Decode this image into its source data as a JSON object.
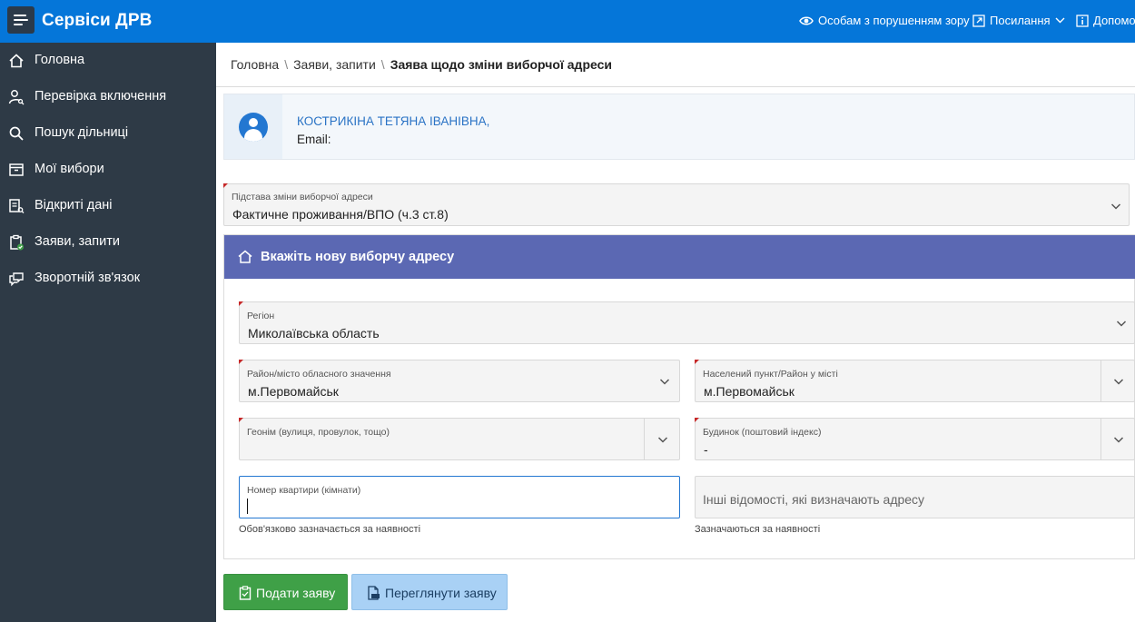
{
  "header": {
    "app_title": "Сервіси ДРВ",
    "accessibility_label": "Особам з порушенням зору",
    "links_label": "Посилання",
    "help_label": "Допомо"
  },
  "sidebar": {
    "items": [
      {
        "label": "Головна",
        "icon": "home-icon"
      },
      {
        "label": "Перевірка включення",
        "icon": "user-search-icon"
      },
      {
        "label": "Пошук дільниці",
        "icon": "search-icon"
      },
      {
        "label": "Мої вибори",
        "icon": "archive-box-icon"
      },
      {
        "label": "Відкриті дані",
        "icon": "database-icon"
      },
      {
        "label": "Заяви, запити",
        "icon": "clipboard-check-icon"
      },
      {
        "label": "Зворотній зв'язок",
        "icon": "chat-bubbles-icon"
      }
    ]
  },
  "breadcrumb": {
    "home": "Головна",
    "section": "Заяви, запити",
    "current": "Заява щодо зміни виборчої адреси"
  },
  "user": {
    "name": "КОСТРИКІНА ТЕТЯНА ІВАНІВНА,",
    "email_label": "Email:"
  },
  "form": {
    "reason": {
      "label": "Підстава зміни виборчої адреси",
      "value": "Фактичне проживання/ВПО (ч.3 ст.8)"
    },
    "address_section_title": "Вкажіть нову виборчу адресу",
    "region": {
      "label": "Регіон",
      "value": "Миколаївська область"
    },
    "district": {
      "label": "Район/місто обласного значення",
      "value": "м.Первомайськ"
    },
    "settlement": {
      "label": "Населений пункт/Район у місті",
      "value": "м.Первомайськ"
    },
    "street": {
      "label": "Геонім (вулиця, провулок, тощо)",
      "value": ""
    },
    "building": {
      "label": "Будинок (поштовий індекс)",
      "value": "-"
    },
    "apartment": {
      "label": "Номер квартири (кімнати)",
      "value": "",
      "hint": "Обов'язково зазначається за наявності"
    },
    "other_info": {
      "placeholder": "Інші відомості, які визначають адресу",
      "hint": "Зазначаються за наявності"
    }
  },
  "actions": {
    "submit_label": "Подати заяву",
    "preview_label": "Переглянути заяву"
  },
  "colors": {
    "topbar": "#0576d9",
    "sidebar": "#2e3a46",
    "section_header": "#5b68b3",
    "submit_button": "#3fa047",
    "preview_button": "#a9d1f5"
  }
}
